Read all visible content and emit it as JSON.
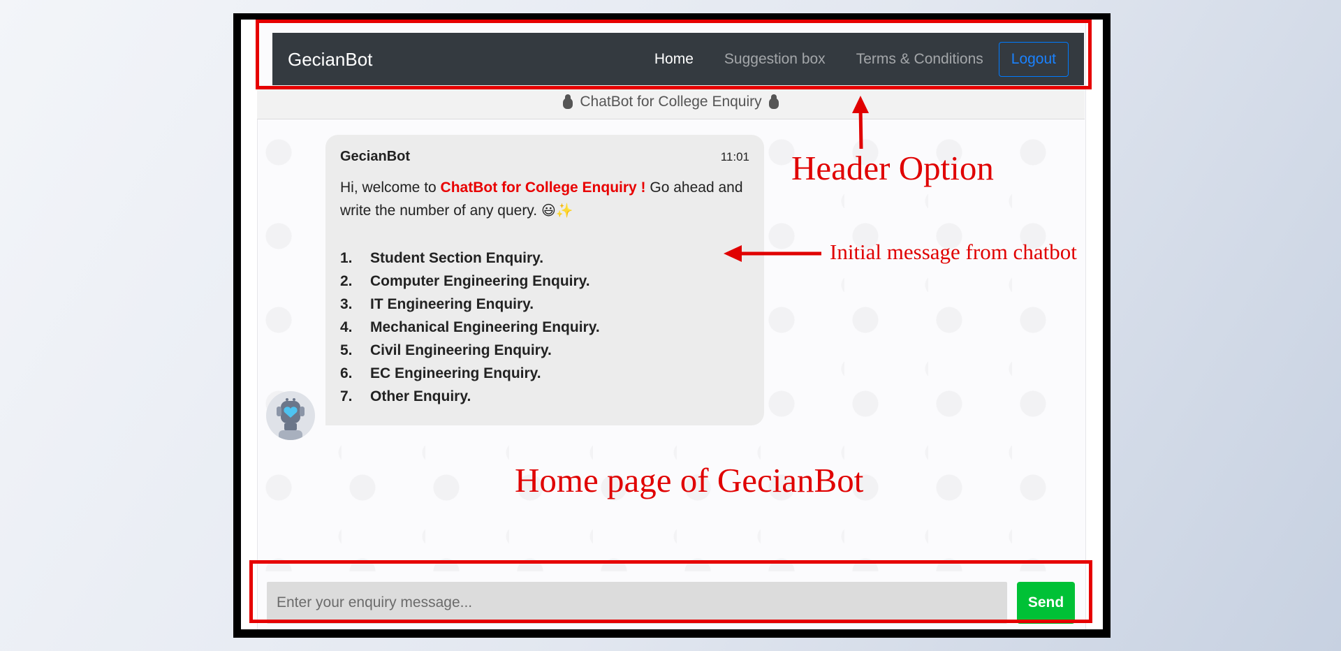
{
  "navbar": {
    "brand": "GecianBot",
    "links": [
      "Home",
      "Suggestion box",
      "Terms & Conditions"
    ],
    "logout_label": "Logout"
  },
  "subheader": {
    "title": "ChatBot for College Enquiry"
  },
  "chat": {
    "sender": "GecianBot",
    "time": "11:01",
    "greeting_prefix": "Hi, welcome to ",
    "greeting_highlight": "ChatBot for College Enquiry !",
    "greeting_suffix": " Go ahead and write the number of any query.",
    "emoji_smile": "😃",
    "emoji_sparkle": "✨",
    "options": [
      {
        "num": "1.",
        "label": "Student Section Enquiry."
      },
      {
        "num": "2.",
        "label": "Computer Engineering Enquiry."
      },
      {
        "num": "3.",
        "label": "IT Engineering Enquiry."
      },
      {
        "num": "4.",
        "label": "Mechanical Engineering Enquiry."
      },
      {
        "num": "5.",
        "label": "Civil Engineering Enquiry."
      },
      {
        "num": "6.",
        "label": "EC Engineering Enquiry."
      },
      {
        "num": "7.",
        "label": "Other Enquiry."
      }
    ]
  },
  "input": {
    "placeholder": "Enter your enquiry message...",
    "send_label": "Send"
  },
  "annotations": {
    "header_option": "Header Option",
    "initial_message": "Initial message from chatbot",
    "home_page": "Home page of GecianBot"
  },
  "colors": {
    "navbar": "#343a40",
    "highlight": "#e80000",
    "send": "#00c136",
    "annotation": "#e00000",
    "logout": "#007bff"
  }
}
